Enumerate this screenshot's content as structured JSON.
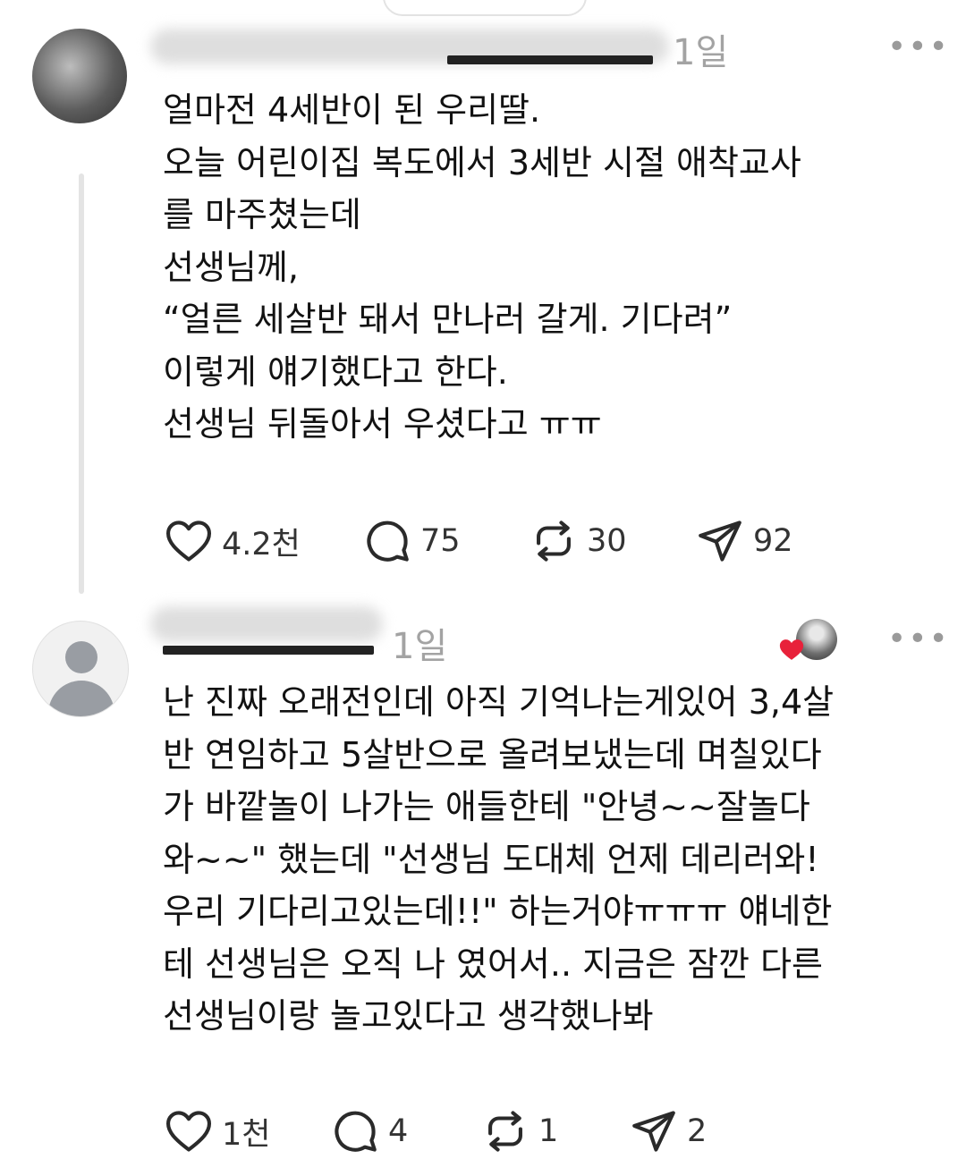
{
  "posts": [
    {
      "time": "1일",
      "more": "•••",
      "text": "얼마전 4세반이 된 우리딸.\n오늘 어린이집 복도에서 3세반 시절 애착교사\n를 마주쳤는데\n선생님께,\n“얼른 세살반 돼서 만나러 갈게. 기다려”\n이렇게 얘기했다고 한다.\n선생님 뒤돌아서 우셨다고 ㅠㅠ",
      "likes": "4.2천",
      "comments": "75",
      "reposts": "30",
      "shares": "92"
    },
    {
      "time": "1일",
      "more": "•••",
      "text": "난 진짜 오래전인데 아직 기억나는게있어 3,4살\n반 연임하고 5살반으로 올려보냈는데 며칠있다\n가 바깥놀이 나가는 애들한테 \"안녕~~잘놀다\n와~~\" 했는데 \"선생님 도대체 언제 데리러와!\n우리 기다리고있는데!!\" 하는거야ㅠㅠㅠ 얘네한\n테 선생님은 오직 나 였어서.. 지금은 잠깐 다른\n선생님이랑 놀고있다고 생각했나봐",
      "likes": "1천",
      "comments": "4",
      "reposts": "1",
      "shares": "2"
    }
  ],
  "colors": {
    "heart_badge": "#e8213a",
    "icon": "#2a2a2a",
    "muted": "#a3a3a3"
  },
  "icons": [
    "heart-icon",
    "comment-icon",
    "repost-icon",
    "share-icon",
    "more-icon"
  ]
}
